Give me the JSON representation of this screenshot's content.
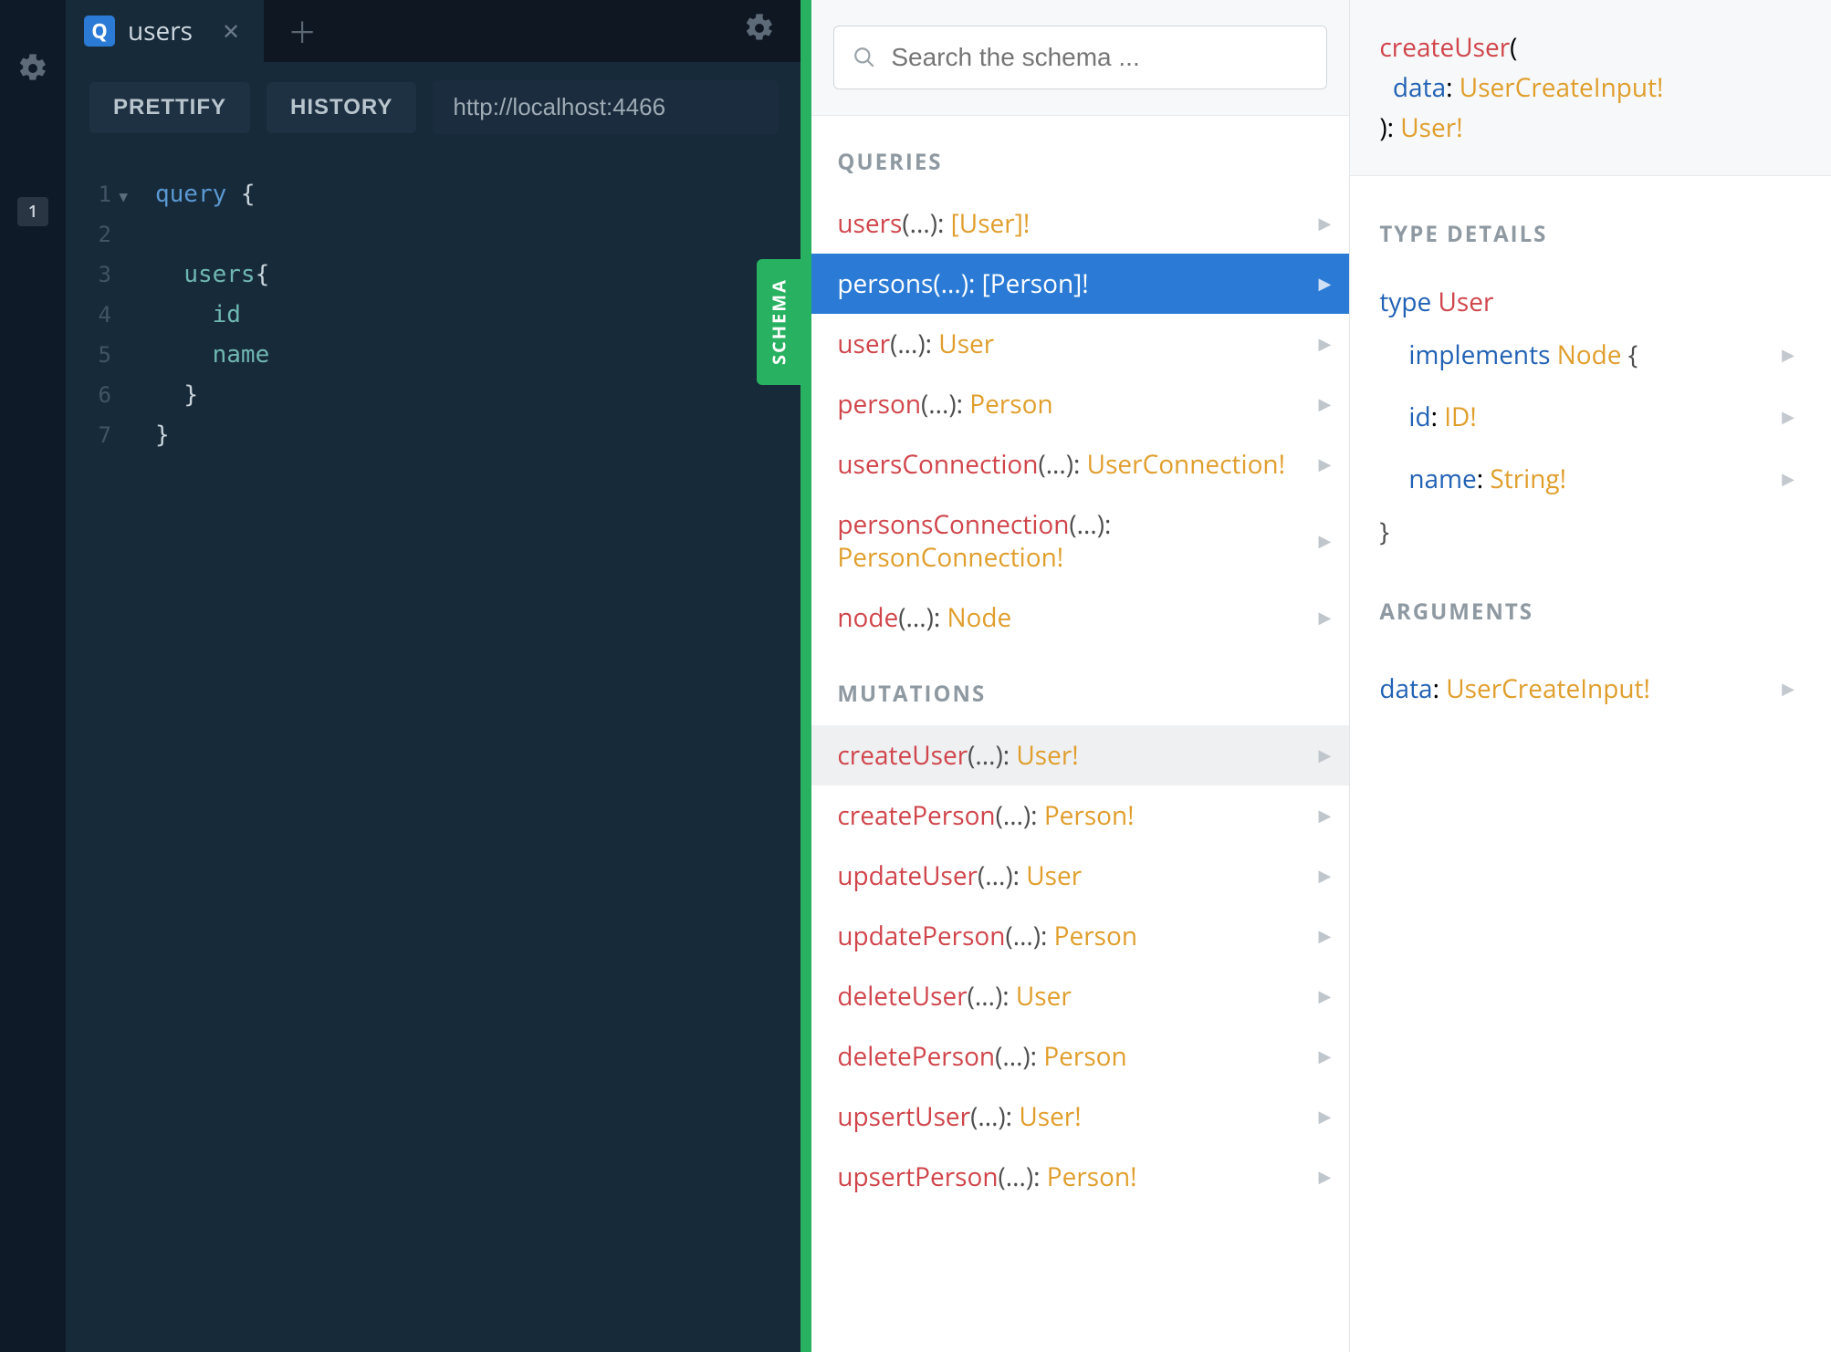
{
  "gutter": {
    "badge": "1"
  },
  "tab": {
    "icon_letter": "Q",
    "title": "users"
  },
  "toolbar": {
    "prettify": "PRETTIFY",
    "history": "HISTORY",
    "endpoint": "http://localhost:4466"
  },
  "editor": {
    "lines": [
      "1",
      "2",
      "3",
      "4",
      "5",
      "6",
      "7"
    ],
    "code": {
      "l1_kw": "query",
      "l1_br": " {",
      "l3_fn": "users",
      "l3_br": "{",
      "l4": "id",
      "l5": "name",
      "l6": "}",
      "l7": "}"
    }
  },
  "schema_tab_label": "SCHEMA",
  "search_placeholder": "Search the schema ...",
  "sections": {
    "queries": "QUERIES",
    "mutations": "MUTATIONS"
  },
  "queries": [
    {
      "name": "users",
      "args": "(...): ",
      "ret": "[User]!"
    },
    {
      "name": "persons",
      "args": "(...): ",
      "ret": "[Person]!"
    },
    {
      "name": "user",
      "args": "(...): ",
      "ret": "User"
    },
    {
      "name": "person",
      "args": "(...): ",
      "ret": "Person"
    },
    {
      "name": "usersConnection",
      "args": "(...): ",
      "ret": "UserConnection!"
    },
    {
      "name": "personsConnection",
      "args": "(...): ",
      "ret": "PersonConnection!"
    },
    {
      "name": "node",
      "args": "(...): ",
      "ret": "Node"
    }
  ],
  "mutations": [
    {
      "name": "createUser",
      "args": "(...): ",
      "ret": "User!"
    },
    {
      "name": "createPerson",
      "args": "(...): ",
      "ret": "Person!"
    },
    {
      "name": "updateUser",
      "args": "(...): ",
      "ret": "User"
    },
    {
      "name": "updatePerson",
      "args": "(...): ",
      "ret": "Person"
    },
    {
      "name": "deleteUser",
      "args": "(...): ",
      "ret": "User"
    },
    {
      "name": "deletePerson",
      "args": "(...): ",
      "ret": "Person"
    },
    {
      "name": "upsertUser",
      "args": "(...): ",
      "ret": "User!"
    },
    {
      "name": "upsertPerson",
      "args": "(...): ",
      "ret": "Person!"
    }
  ],
  "signature": {
    "name": "createUser",
    "open": "(",
    "argname": "data",
    "colon1": ": ",
    "argtype": "UserCreateInput!",
    "close": "): ",
    "rettype": "User!"
  },
  "details": {
    "title": "TYPE DETAILS",
    "type_kw": "type ",
    "type_name": "User",
    "implements_kw": "implements ",
    "implements_name": "Node",
    "open_brace": " {",
    "fields": [
      {
        "name": "id",
        "colon": ": ",
        "type": "ID!"
      },
      {
        "name": "name",
        "colon": ": ",
        "type": "String!"
      }
    ],
    "close_brace": "}"
  },
  "arguments": {
    "title": "ARGUMENTS",
    "arg_name": "data",
    "arg_colon": ": ",
    "arg_type": "UserCreateInput!"
  }
}
